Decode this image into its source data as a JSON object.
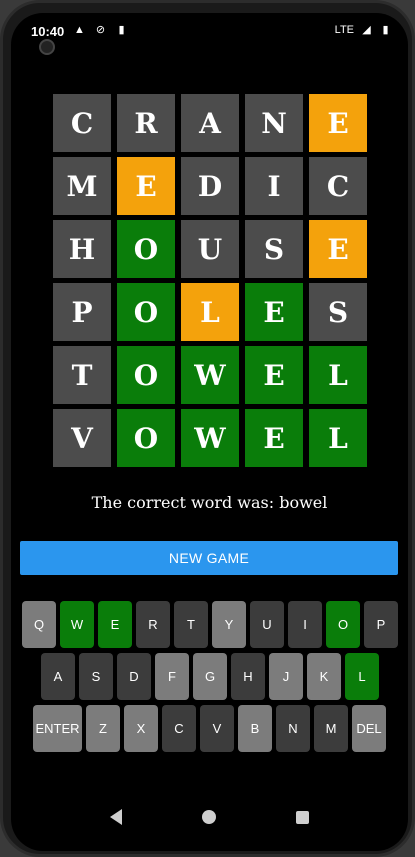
{
  "status_bar": {
    "time": "10:40",
    "network": "LTE",
    "icons": [
      "alert-icon",
      "sync-icon",
      "sd-card-icon",
      "signal-icon",
      "battery-icon"
    ]
  },
  "board": [
    [
      {
        "l": "C",
        "s": "gray"
      },
      {
        "l": "R",
        "s": "gray"
      },
      {
        "l": "A",
        "s": "gray"
      },
      {
        "l": "N",
        "s": "gray"
      },
      {
        "l": "E",
        "s": "orange"
      }
    ],
    [
      {
        "l": "M",
        "s": "gray"
      },
      {
        "l": "E",
        "s": "orange"
      },
      {
        "l": "D",
        "s": "gray"
      },
      {
        "l": "I",
        "s": "gray"
      },
      {
        "l": "C",
        "s": "gray"
      }
    ],
    [
      {
        "l": "H",
        "s": "gray"
      },
      {
        "l": "O",
        "s": "green"
      },
      {
        "l": "U",
        "s": "gray"
      },
      {
        "l": "S",
        "s": "gray"
      },
      {
        "l": "E",
        "s": "orange"
      }
    ],
    [
      {
        "l": "P",
        "s": "gray"
      },
      {
        "l": "O",
        "s": "green"
      },
      {
        "l": "L",
        "s": "orange"
      },
      {
        "l": "E",
        "s": "green"
      },
      {
        "l": "S",
        "s": "gray"
      }
    ],
    [
      {
        "l": "T",
        "s": "gray"
      },
      {
        "l": "O",
        "s": "green"
      },
      {
        "l": "W",
        "s": "green"
      },
      {
        "l": "E",
        "s": "green"
      },
      {
        "l": "L",
        "s": "green"
      }
    ],
    [
      {
        "l": "V",
        "s": "gray"
      },
      {
        "l": "O",
        "s": "green"
      },
      {
        "l": "W",
        "s": "green"
      },
      {
        "l": "E",
        "s": "green"
      },
      {
        "l": "L",
        "s": "green"
      }
    ]
  ],
  "result_text": "The correct word was: bowel",
  "new_game_label": "NEW GAME",
  "keyboard": [
    [
      {
        "k": "Q",
        "s": "light"
      },
      {
        "k": "W",
        "s": "green"
      },
      {
        "k": "E",
        "s": "green"
      },
      {
        "k": "R",
        "s": "dark"
      },
      {
        "k": "T",
        "s": "dark"
      },
      {
        "k": "Y",
        "s": "light"
      },
      {
        "k": "U",
        "s": "dark"
      },
      {
        "k": "I",
        "s": "dark"
      },
      {
        "k": "O",
        "s": "green"
      },
      {
        "k": "P",
        "s": "dark"
      }
    ],
    [
      {
        "k": "A",
        "s": "dark"
      },
      {
        "k": "S",
        "s": "dark"
      },
      {
        "k": "D",
        "s": "dark"
      },
      {
        "k": "F",
        "s": "light"
      },
      {
        "k": "G",
        "s": "light"
      },
      {
        "k": "H",
        "s": "dark"
      },
      {
        "k": "J",
        "s": "light"
      },
      {
        "k": "K",
        "s": "light"
      },
      {
        "k": "L",
        "s": "green"
      }
    ],
    [
      {
        "k": "ENTER",
        "s": "light"
      },
      {
        "k": "Z",
        "s": "light"
      },
      {
        "k": "X",
        "s": "light"
      },
      {
        "k": "C",
        "s": "dark"
      },
      {
        "k": "V",
        "s": "dark"
      },
      {
        "k": "B",
        "s": "light"
      },
      {
        "k": "N",
        "s": "dark"
      },
      {
        "k": "M",
        "s": "dark"
      },
      {
        "k": "DEL",
        "s": "light"
      }
    ]
  ],
  "colors": {
    "correct": "#0a7d0a",
    "present": "#f4a20c",
    "absent": "#4c4c4c",
    "button": "#2b96ee"
  }
}
